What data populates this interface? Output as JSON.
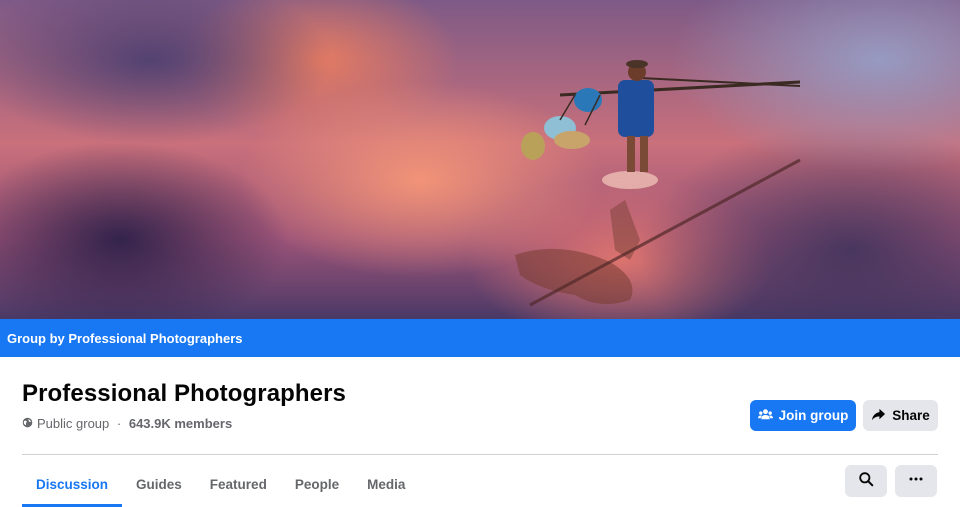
{
  "group": {
    "banner_text": "Group by Professional Photographers",
    "name": "Professional Photographers",
    "privacy": "Public group",
    "separator": " · ",
    "members": "643.9K members"
  },
  "actions": {
    "join_label": "Join group",
    "share_label": "Share"
  },
  "tabs": [
    {
      "label": "Discussion",
      "active": true
    },
    {
      "label": "Guides",
      "active": false
    },
    {
      "label": "Featured",
      "active": false
    },
    {
      "label": "People",
      "active": false
    },
    {
      "label": "Media",
      "active": false
    }
  ],
  "icons": {
    "privacy": "globe-icon",
    "join": "people-icon",
    "share": "share-arrow-icon",
    "search": "search-icon",
    "more": "more-dots-icon"
  },
  "colors": {
    "accent": "#1877f2",
    "secondary_button": "#e4e6eb",
    "muted_text": "#65676b"
  }
}
